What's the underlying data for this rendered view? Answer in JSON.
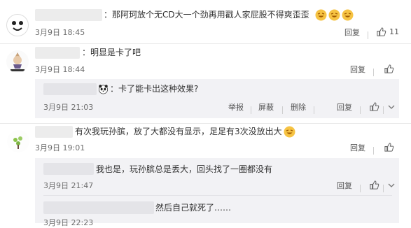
{
  "comments": [
    {
      "text": "：那阿珂放个无CD大一个劲再用戳人家屁股不得爽歪歪",
      "emoji_count": 3,
      "date": "3月9日 18:45",
      "reply": "回复",
      "likes": "11"
    },
    {
      "text": "：明显是卡了吧",
      "date": "3月9日 18:44",
      "reply": "回复",
      "likes": "",
      "sub": {
        "text": "：卡了能卡出这种效果?",
        "date": "3月9日 21:03",
        "actions": [
          "举报",
          "屏蔽",
          "删除",
          "回复"
        ]
      }
    },
    {
      "text": "有次我玩孙膑，放了大都没有显示，足足有3次没放出大",
      "date": "3月9日 19:01",
      "reply": "回复",
      "likes": "",
      "subs": [
        {
          "text": "我也是，玩孙膑总是丢大，回头找了一圈都没有",
          "date": "3月9日 21:47",
          "reply": "回复"
        },
        {
          "text": "然后自己就死了……",
          "date": "3月9日 22:23"
        }
      ]
    }
  ],
  "colors": {
    "reply_bg": "#f2f2f5",
    "divider": "#e9e9e9",
    "emoji": "#f6c343"
  }
}
